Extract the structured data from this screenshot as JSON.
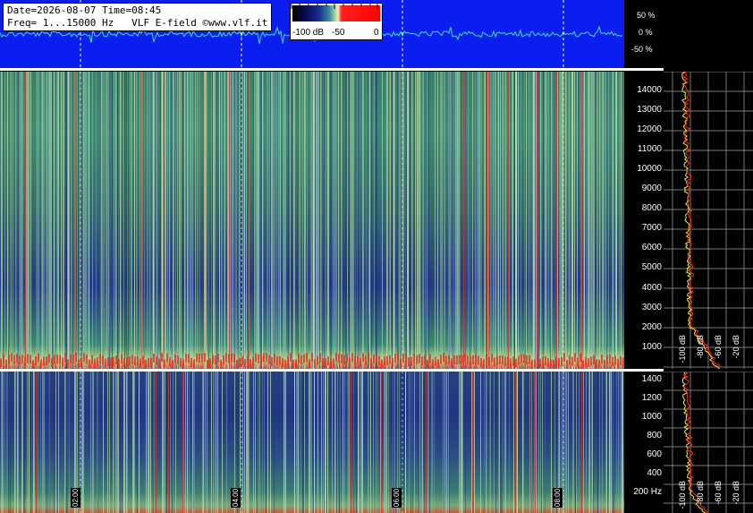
{
  "header": {
    "date_line": "Date=2026-08-07 Time=08:45",
    "freq_line": "Freq= 1...15000 Hz   VLF E-field ©www.vlf.it"
  },
  "color_scale": {
    "labels": [
      "-100 dB",
      "-50",
      "0"
    ]
  },
  "waveform_axis": {
    "labels": [
      "50 %",
      "0 %",
      "-50 %"
    ]
  },
  "freq_axis_top": {
    "labels": [
      "14000",
      "13000",
      "12000",
      "11000",
      "10000",
      "9000",
      "8000",
      "7000",
      "6000",
      "5000",
      "4000",
      "3000",
      "2000",
      "1000"
    ]
  },
  "freq_axis_bottom": {
    "labels": [
      "1400",
      "1200",
      "1000",
      "800",
      "600",
      "400",
      "200 Hz"
    ]
  },
  "time_axis": {
    "labels": [
      "02:00",
      "04:00",
      "06:00",
      "08:00"
    ]
  },
  "profile_top": {
    "db_labels": [
      "-100 dB",
      "-80 dB",
      "-60 dB",
      "-40 dB",
      "-20 dB"
    ]
  },
  "profile_bottom": {
    "db_labels": [
      "-100 dB",
      "-80 dB",
      "-60 dB",
      "-40 dB",
      "-20 dB"
    ]
  },
  "colors": {
    "wave_bg": "#0a1ef0",
    "wave_line": "#40e0d0",
    "trace_red": "#ff2a1a",
    "trace_yellow": "#e8f040"
  }
}
